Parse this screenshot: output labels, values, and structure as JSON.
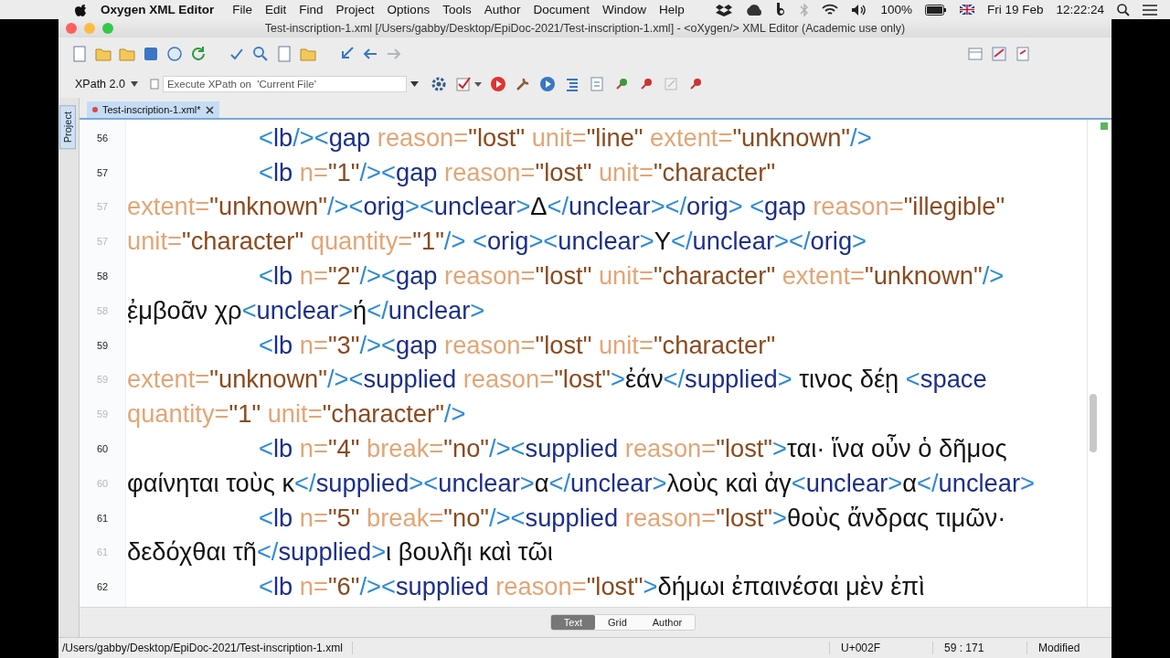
{
  "menu_bar": {
    "app_name": "Oxygen XML Editor",
    "menus": [
      "File",
      "Edit",
      "Find",
      "Project",
      "Options",
      "Tools",
      "Author",
      "Document",
      "Window",
      "Help"
    ],
    "battery": "100%",
    "date": "Fri 19 Feb",
    "time": "12:22:24"
  },
  "window": {
    "title": "Test-inscription-1.xml [/Users/gabby/Desktop/EpiDoc-2021/Test-inscription-1.xml] - <oXygen/> XML Editor (Academic use only)"
  },
  "xpath_bar": {
    "version": "XPath 2.0",
    "placeholder": "Execute XPath on  'Current File'"
  },
  "side_tab": "Project",
  "editor_tabs": [
    {
      "label": "Test-inscription-1.xml*",
      "selected": true,
      "modified": true
    }
  ],
  "code_lines": [
    {
      "number": "56",
      "wrapped": false,
      "tokens": [
        {
          "kind": "punct",
          "text": "<"
        },
        {
          "kind": "tag",
          "text": "lb"
        },
        {
          "kind": "punct",
          "text": "/><"
        },
        {
          "kind": "tag",
          "text": "gap"
        },
        {
          "kind": "attr",
          "text": " reason="
        },
        {
          "kind": "value",
          "text": "\"lost\""
        },
        {
          "kind": "attr",
          "text": " unit="
        },
        {
          "kind": "value",
          "text": "\"line\""
        },
        {
          "kind": "attr",
          "text": " extent="
        },
        {
          "kind": "value",
          "text": "\"unknown\""
        },
        {
          "kind": "punct",
          "text": "/>"
        }
      ]
    },
    {
      "number": "57",
      "wrapped": false,
      "tokens": [
        {
          "kind": "punct",
          "text": "<"
        },
        {
          "kind": "tag",
          "text": "lb"
        },
        {
          "kind": "attr",
          "text": " n="
        },
        {
          "kind": "value",
          "text": "\"1\""
        },
        {
          "kind": "punct",
          "text": "/><"
        },
        {
          "kind": "tag",
          "text": "gap"
        },
        {
          "kind": "attr",
          "text": " reason="
        },
        {
          "kind": "value",
          "text": "\"lost\""
        },
        {
          "kind": "attr",
          "text": " unit="
        },
        {
          "kind": "value",
          "text": "\"character\""
        }
      ]
    },
    {
      "number": "57",
      "wrapped": true,
      "tokens": [
        {
          "kind": "attr",
          "text": "extent="
        },
        {
          "kind": "value",
          "text": "\"unknown\""
        },
        {
          "kind": "punct",
          "text": "/><"
        },
        {
          "kind": "tag",
          "text": "orig"
        },
        {
          "kind": "punct",
          "text": "><"
        },
        {
          "kind": "tag",
          "text": "unclear"
        },
        {
          "kind": "punct",
          "text": ">"
        },
        {
          "kind": "text",
          "text": "Δ"
        },
        {
          "kind": "punct",
          "text": "</"
        },
        {
          "kind": "tag",
          "text": "unclear"
        },
        {
          "kind": "punct",
          "text": "></"
        },
        {
          "kind": "tag",
          "text": "orig"
        },
        {
          "kind": "punct",
          "text": "> <"
        },
        {
          "kind": "tag",
          "text": "gap"
        },
        {
          "kind": "attr",
          "text": " reason="
        },
        {
          "kind": "value",
          "text": "\"illegible\""
        }
      ]
    },
    {
      "number": "57",
      "wrapped": true,
      "tokens": [
        {
          "kind": "attr",
          "text": "unit="
        },
        {
          "kind": "value",
          "text": "\"character\""
        },
        {
          "kind": "attr",
          "text": " quantity="
        },
        {
          "kind": "value",
          "text": "\"1\""
        },
        {
          "kind": "punct",
          "text": "/> <"
        },
        {
          "kind": "tag",
          "text": "orig"
        },
        {
          "kind": "punct",
          "text": "><"
        },
        {
          "kind": "tag",
          "text": "unclear"
        },
        {
          "kind": "punct",
          "text": ">"
        },
        {
          "kind": "text",
          "text": "Y"
        },
        {
          "kind": "punct",
          "text": "</"
        },
        {
          "kind": "tag",
          "text": "unclear"
        },
        {
          "kind": "punct",
          "text": "></"
        },
        {
          "kind": "tag",
          "text": "orig"
        },
        {
          "kind": "punct",
          "text": ">"
        }
      ]
    },
    {
      "number": "58",
      "wrapped": false,
      "tokens": [
        {
          "kind": "punct",
          "text": "<"
        },
        {
          "kind": "tag",
          "text": "lb"
        },
        {
          "kind": "attr",
          "text": " n="
        },
        {
          "kind": "value",
          "text": "\"2\""
        },
        {
          "kind": "punct",
          "text": "/><"
        },
        {
          "kind": "tag",
          "text": "gap"
        },
        {
          "kind": "attr",
          "text": " reason="
        },
        {
          "kind": "value",
          "text": "\"lost\""
        },
        {
          "kind": "attr",
          "text": " unit="
        },
        {
          "kind": "value",
          "text": "\"character\""
        },
        {
          "kind": "attr",
          "text": " extent="
        },
        {
          "kind": "value",
          "text": "\"unknown\""
        },
        {
          "kind": "punct",
          "text": "/>"
        }
      ]
    },
    {
      "number": "58",
      "wrapped": true,
      "tokens": [
        {
          "kind": "text",
          "text": "ἐ̣μβοᾶν χρ"
        },
        {
          "kind": "punct",
          "text": "<"
        },
        {
          "kind": "tag",
          "text": "unclear"
        },
        {
          "kind": "punct",
          "text": ">"
        },
        {
          "kind": "text",
          "text": "ή"
        },
        {
          "kind": "punct",
          "text": "</"
        },
        {
          "kind": "tag",
          "text": "unclear"
        },
        {
          "kind": "punct",
          "text": ">"
        }
      ]
    },
    {
      "number": "59",
      "wrapped": false,
      "tokens": [
        {
          "kind": "punct",
          "text": "<"
        },
        {
          "kind": "tag",
          "text": "lb"
        },
        {
          "kind": "attr",
          "text": " n="
        },
        {
          "kind": "value",
          "text": "\"3\""
        },
        {
          "kind": "punct",
          "text": "/><"
        },
        {
          "kind": "tag",
          "text": "gap"
        },
        {
          "kind": "attr",
          "text": " reason="
        },
        {
          "kind": "value",
          "text": "\"lost\""
        },
        {
          "kind": "attr",
          "text": " unit="
        },
        {
          "kind": "value",
          "text": "\"character\""
        }
      ]
    },
    {
      "number": "59",
      "wrapped": true,
      "tokens": [
        {
          "kind": "attr",
          "text": "extent="
        },
        {
          "kind": "value",
          "text": "\"unknown\""
        },
        {
          "kind": "punct",
          "text": "/><"
        },
        {
          "kind": "tag",
          "text": "supplied"
        },
        {
          "kind": "attr",
          "text": " reason="
        },
        {
          "kind": "value",
          "text": "\"lost\""
        },
        {
          "kind": "punct",
          "text": ">"
        },
        {
          "kind": "text",
          "text": "ἐάν"
        },
        {
          "kind": "punct",
          "text": "</"
        },
        {
          "kind": "tag",
          "text": "supplied"
        },
        {
          "kind": "punct",
          "text": ">"
        },
        {
          "kind": "text",
          "text": " τινος δέῃ "
        },
        {
          "kind": "punct",
          "text": "<"
        },
        {
          "kind": "tag",
          "text": "space"
        }
      ]
    },
    {
      "number": "59",
      "wrapped": true,
      "tokens": [
        {
          "kind": "attr",
          "text": "quantity="
        },
        {
          "kind": "value",
          "text": "\"1\""
        },
        {
          "kind": "attr",
          "text": " unit="
        },
        {
          "kind": "value",
          "text": "\"character\""
        },
        {
          "kind": "punct",
          "text": "/>"
        }
      ]
    },
    {
      "number": "60",
      "wrapped": false,
      "tokens": [
        {
          "kind": "punct",
          "text": "<"
        },
        {
          "kind": "tag",
          "text": "lb"
        },
        {
          "kind": "attr",
          "text": " n="
        },
        {
          "kind": "value",
          "text": "\"4\""
        },
        {
          "kind": "attr",
          "text": " break="
        },
        {
          "kind": "value",
          "text": "\"no\""
        },
        {
          "kind": "punct",
          "text": "/><"
        },
        {
          "kind": "tag",
          "text": "supplied"
        },
        {
          "kind": "attr",
          "text": " reason="
        },
        {
          "kind": "value",
          "text": "\"lost\""
        },
        {
          "kind": "punct",
          "text": ">"
        },
        {
          "kind": "text",
          "text": "ται· ἵνα οὖν ὁ δῆμος"
        }
      ]
    },
    {
      "number": "60",
      "wrapped": true,
      "tokens": [
        {
          "kind": "text",
          "text": "φαίνηται τοὺς κ"
        },
        {
          "kind": "punct",
          "text": "</"
        },
        {
          "kind": "tag",
          "text": "supplied"
        },
        {
          "kind": "punct",
          "text": "><"
        },
        {
          "kind": "tag",
          "text": "unclear"
        },
        {
          "kind": "punct",
          "text": ">"
        },
        {
          "kind": "text",
          "text": "α"
        },
        {
          "kind": "punct",
          "text": "</"
        },
        {
          "kind": "tag",
          "text": "unclear"
        },
        {
          "kind": "punct",
          "text": ">"
        },
        {
          "kind": "text",
          "text": "λοὺς καὶ ἀγ"
        },
        {
          "kind": "punct",
          "text": "<"
        },
        {
          "kind": "tag",
          "text": "unclear"
        },
        {
          "kind": "punct",
          "text": ">"
        },
        {
          "kind": "text",
          "text": "α"
        },
        {
          "kind": "punct",
          "text": "</"
        },
        {
          "kind": "tag",
          "text": "unclear"
        },
        {
          "kind": "punct",
          "text": ">"
        }
      ]
    },
    {
      "number": "61",
      "wrapped": false,
      "tokens": [
        {
          "kind": "punct",
          "text": "<"
        },
        {
          "kind": "tag",
          "text": "lb"
        },
        {
          "kind": "attr",
          "text": " n="
        },
        {
          "kind": "value",
          "text": "\"5\""
        },
        {
          "kind": "attr",
          "text": " break="
        },
        {
          "kind": "value",
          "text": "\"no\""
        },
        {
          "kind": "punct",
          "text": "/><"
        },
        {
          "kind": "tag",
          "text": "supplied"
        },
        {
          "kind": "attr",
          "text": " reason="
        },
        {
          "kind": "value",
          "text": "\"lost\""
        },
        {
          "kind": "punct",
          "text": ">"
        },
        {
          "kind": "text",
          "text": "θοὺς ἄνδρας τιμῶν·"
        }
      ]
    },
    {
      "number": "61",
      "wrapped": true,
      "tokens": [
        {
          "kind": "text",
          "text": "δεδόχθαι τῆ"
        },
        {
          "kind": "punct",
          "text": "</"
        },
        {
          "kind": "tag",
          "text": "supplied"
        },
        {
          "kind": "punct",
          "text": ">"
        },
        {
          "kind": "text",
          "text": "ι βουλῆι καὶ τῶι"
        }
      ]
    },
    {
      "number": "62",
      "wrapped": false,
      "tokens": [
        {
          "kind": "punct",
          "text": "<"
        },
        {
          "kind": "tag",
          "text": "lb"
        },
        {
          "kind": "attr",
          "text": " n="
        },
        {
          "kind": "value",
          "text": "\"6\""
        },
        {
          "kind": "punct",
          "text": "/><"
        },
        {
          "kind": "tag",
          "text": "supplied"
        },
        {
          "kind": "attr",
          "text": " reason="
        },
        {
          "kind": "value",
          "text": "\"lost\""
        },
        {
          "kind": "punct",
          "text": ">"
        },
        {
          "kind": "text",
          "text": "δήμωι ἐπαινέσαι μὲν ἐπὶ"
        }
      ]
    }
  ],
  "mode_tabs": [
    {
      "label": "Text",
      "selected": true
    },
    {
      "label": "Grid",
      "selected": false
    },
    {
      "label": "Author",
      "selected": false
    }
  ],
  "status_bar": {
    "path": "/Users/gabby/Desktop/EpiDoc-2021/Test-inscription-1.xml",
    "character": "U+002F",
    "position": "59 : 171",
    "state": "Modified"
  }
}
